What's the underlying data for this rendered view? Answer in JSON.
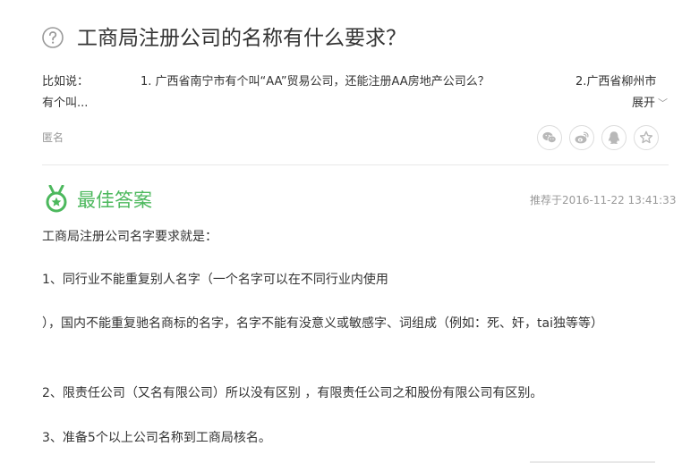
{
  "question": {
    "title": "工商局注册公司的名称有什么要求？",
    "desc_label": "比如说：",
    "desc_part1": "1. 广西省南宁市有个叫“AA”贸易公司，还能注册AA房地产公司么？",
    "desc_part2": "2.广西省柳州市",
    "desc_part3": "有个叫...",
    "expand_label": "展开",
    "asker": "匿名"
  },
  "share": {
    "icons": [
      "wechat-icon",
      "weibo-icon",
      "qq-icon",
      "favorite-star-icon"
    ]
  },
  "best_answer": {
    "title": "最佳答案",
    "recommended": "推荐于2016-11-22 13:41:33",
    "paragraphs": [
      "工商局注册公司名字要求就是：",
      "1、同行业不能重复别人名字（一个名字可以在不同行业内使用",
      "），国内不能重复驰名商标的名字，名字不能有没意义或敏感字、词组成（例如：死、奸，tai独等等）",
      "2、限责任公司（又名有限公司）所以没有区别 ，有限责任公司之和股份有限公司有区别。",
      "3、准备5个以上公司名称到工商局核名。"
    ]
  },
  "colors": {
    "accent_green": "#4cb85d",
    "muted_gray": "#999999",
    "text": "#333333"
  }
}
